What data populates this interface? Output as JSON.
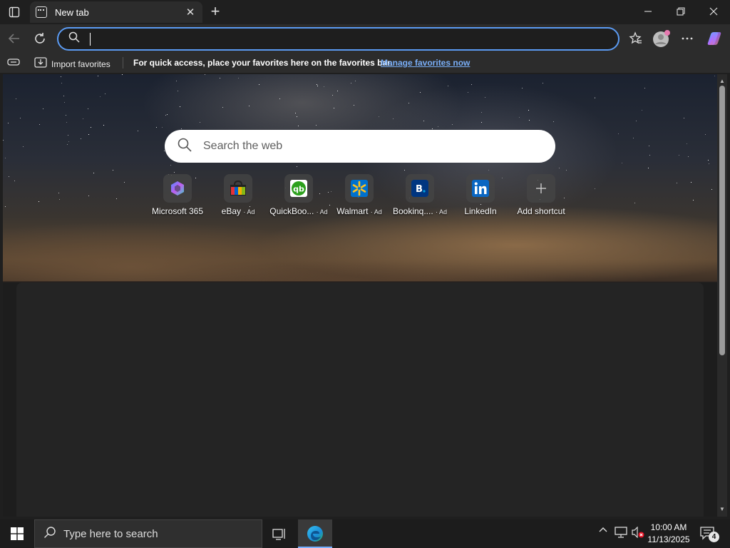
{
  "tab": {
    "title": "New tab"
  },
  "address": {
    "value": ""
  },
  "favorites_bar": {
    "import_label": "Import favorites",
    "message": "For quick access, place your favorites here on the favorites bar.",
    "manage_link": "Manage favorites now"
  },
  "newtab": {
    "search_placeholder": "Search the web",
    "shortcuts": [
      {
        "label": "Microsoft 365",
        "ad": ""
      },
      {
        "label": "eBay",
        "ad": "· Ad"
      },
      {
        "label": "QuickBoo...",
        "ad": "· Ad"
      },
      {
        "label": "Walmart",
        "ad": "· Ad"
      },
      {
        "label": "Bookinq....",
        "ad": "· Ad"
      },
      {
        "label": "LinkedIn",
        "ad": ""
      },
      {
        "label": "Add shortcut",
        "ad": ""
      }
    ]
  },
  "taskbar": {
    "search_placeholder": "Type here to search",
    "time": "10:00 AM",
    "date": "11/13/2025",
    "notification_count": "4"
  },
  "colors": {
    "accent": "#5b9bf3",
    "link": "#79aef7",
    "edge_blue": "#1a8cd8",
    "quickbooks": "#2ca01c",
    "walmart": "#0071ce",
    "booking": "#003580",
    "linkedin": "#0a66c2"
  }
}
